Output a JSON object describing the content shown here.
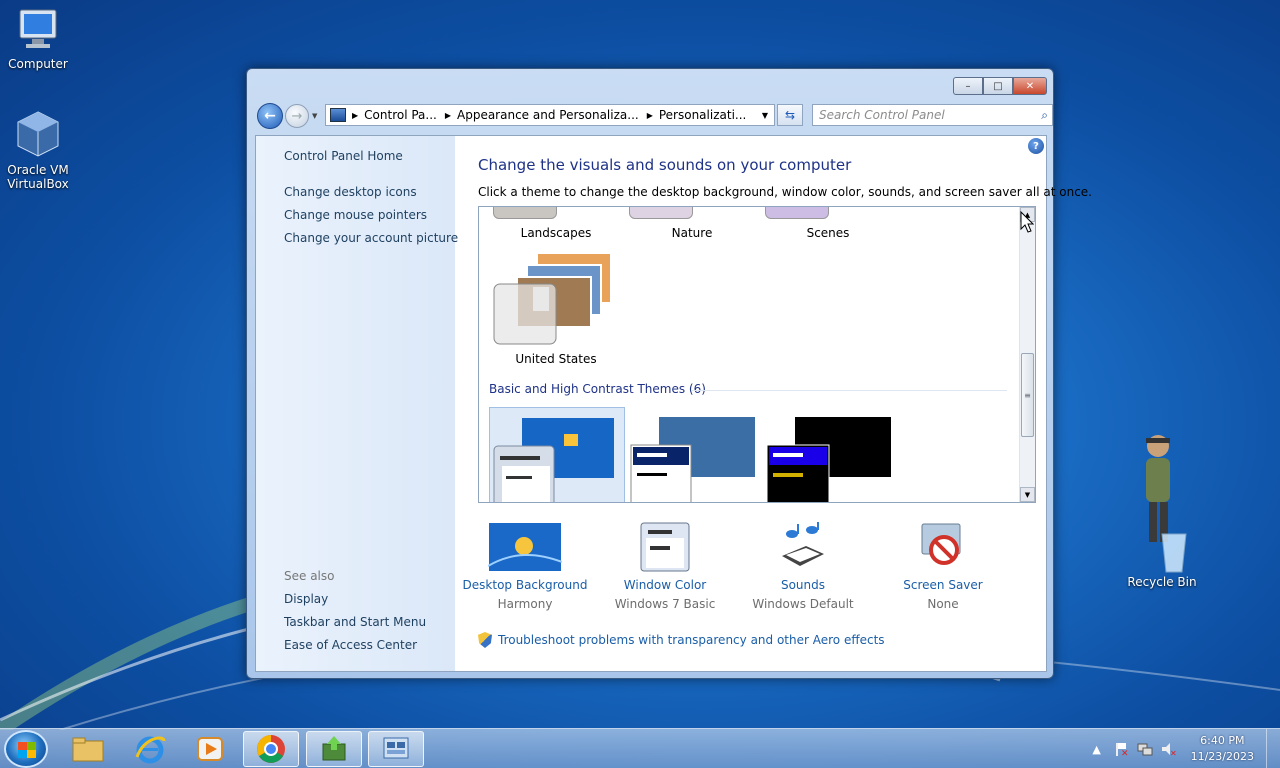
{
  "desktop": {
    "icons": [
      {
        "label": "Computer",
        "icon": "computer-icon"
      },
      {
        "label": "Oracle VM VirtualBox",
        "icon": "virtualbox-icon"
      },
      {
        "label": "Recycle Bin",
        "icon": "recycle-bin-icon"
      }
    ]
  },
  "window": {
    "controls": {
      "minimize": "–",
      "maximize": "□",
      "close": "✕"
    },
    "breadcrumb": [
      "Control Pa...",
      "Appearance and Personaliza...",
      "Personalizati..."
    ],
    "search_placeholder": "Search Control Panel",
    "sidebar": {
      "home": "Control Panel Home",
      "links": [
        "Change desktop icons",
        "Change mouse pointers",
        "Change your account picture"
      ],
      "see_also_heading": "See also",
      "see_also": [
        "Display",
        "Taskbar and Start Menu",
        "Ease of Access Center"
      ]
    },
    "main": {
      "title": "Change the visuals and sounds on your computer",
      "description": "Click a theme to change the desktop background, window color, sounds, and screen saver all at once.",
      "themes_top": [
        "Landscapes",
        "Nature",
        "Scenes"
      ],
      "theme_us": "United States",
      "basic_group_label": "Basic and High Contrast Themes (6)",
      "bottom": [
        {
          "name": "Desktop Background",
          "value": "Harmony",
          "icon": "desktop-background-icon"
        },
        {
          "name": "Window Color",
          "value": "Windows 7 Basic",
          "icon": "window-color-icon"
        },
        {
          "name": "Sounds",
          "value": "Windows Default",
          "icon": "sounds-icon"
        },
        {
          "name": "Screen Saver",
          "value": "None",
          "icon": "screen-saver-icon"
        }
      ],
      "troubleshoot": "Troubleshoot problems with transparency and other Aero effects"
    }
  },
  "taskbar": {
    "apps": [
      "windows-explorer",
      "internet-explorer",
      "media-player",
      "chrome",
      "app-installer",
      "control-panel"
    ],
    "time": "6:40 PM",
    "date": "11/23/2023"
  },
  "colors": {
    "link": "#1a5ea8",
    "title": "#1e3287",
    "wallpaper": "#1a6cc4"
  }
}
